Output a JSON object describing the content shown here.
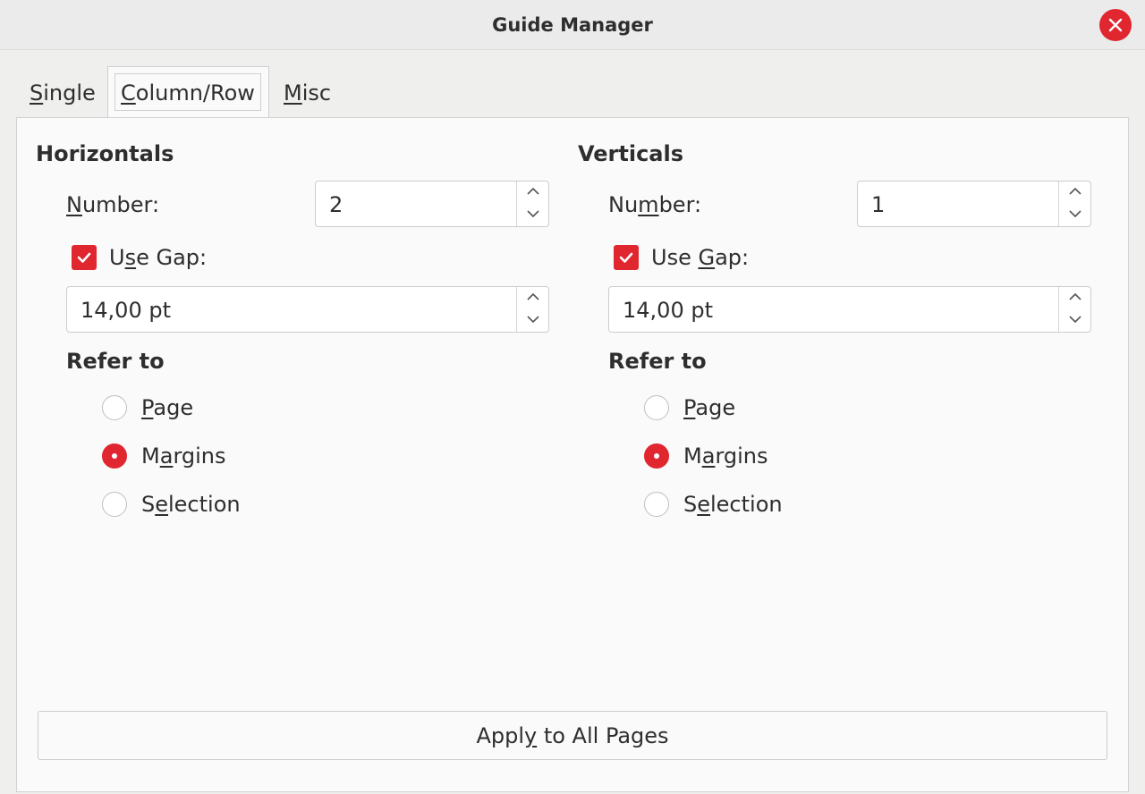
{
  "window": {
    "title": "Guide Manager"
  },
  "tabs": [
    {
      "label": "Single",
      "mnemonic": "S"
    },
    {
      "label": "Column/Row",
      "mnemonic": "C"
    },
    {
      "label": "Misc",
      "mnemonic": "M"
    }
  ],
  "active_tab": "Column/Row",
  "horizontals": {
    "title": "Horizontals",
    "number_label": "Number:",
    "number_value": "2",
    "use_gap_label": "Use Gap:",
    "use_gap_checked": true,
    "gap_value": "14,00 pt",
    "refer_to_label": "Refer to",
    "options": [
      "Page",
      "Margins",
      "Selection"
    ],
    "selected": "Margins"
  },
  "verticals": {
    "title": "Verticals",
    "number_label": "Number:",
    "number_value": "1",
    "use_gap_label": "Use Gap:",
    "use_gap_checked": true,
    "gap_value": "14,00 pt",
    "refer_to_label": "Refer to",
    "options": [
      "Page",
      "Margins",
      "Selection"
    ],
    "selected": "Margins"
  },
  "apply_button_label": "Apply to All Pages",
  "colors": {
    "accent": "#e0262f",
    "background": "#efefee",
    "panel": "#fafafa"
  },
  "icons": {
    "close": "close-icon",
    "check": "check-icon",
    "spin_up": "chevron-up-icon",
    "spin_down": "chevron-down-icon"
  }
}
